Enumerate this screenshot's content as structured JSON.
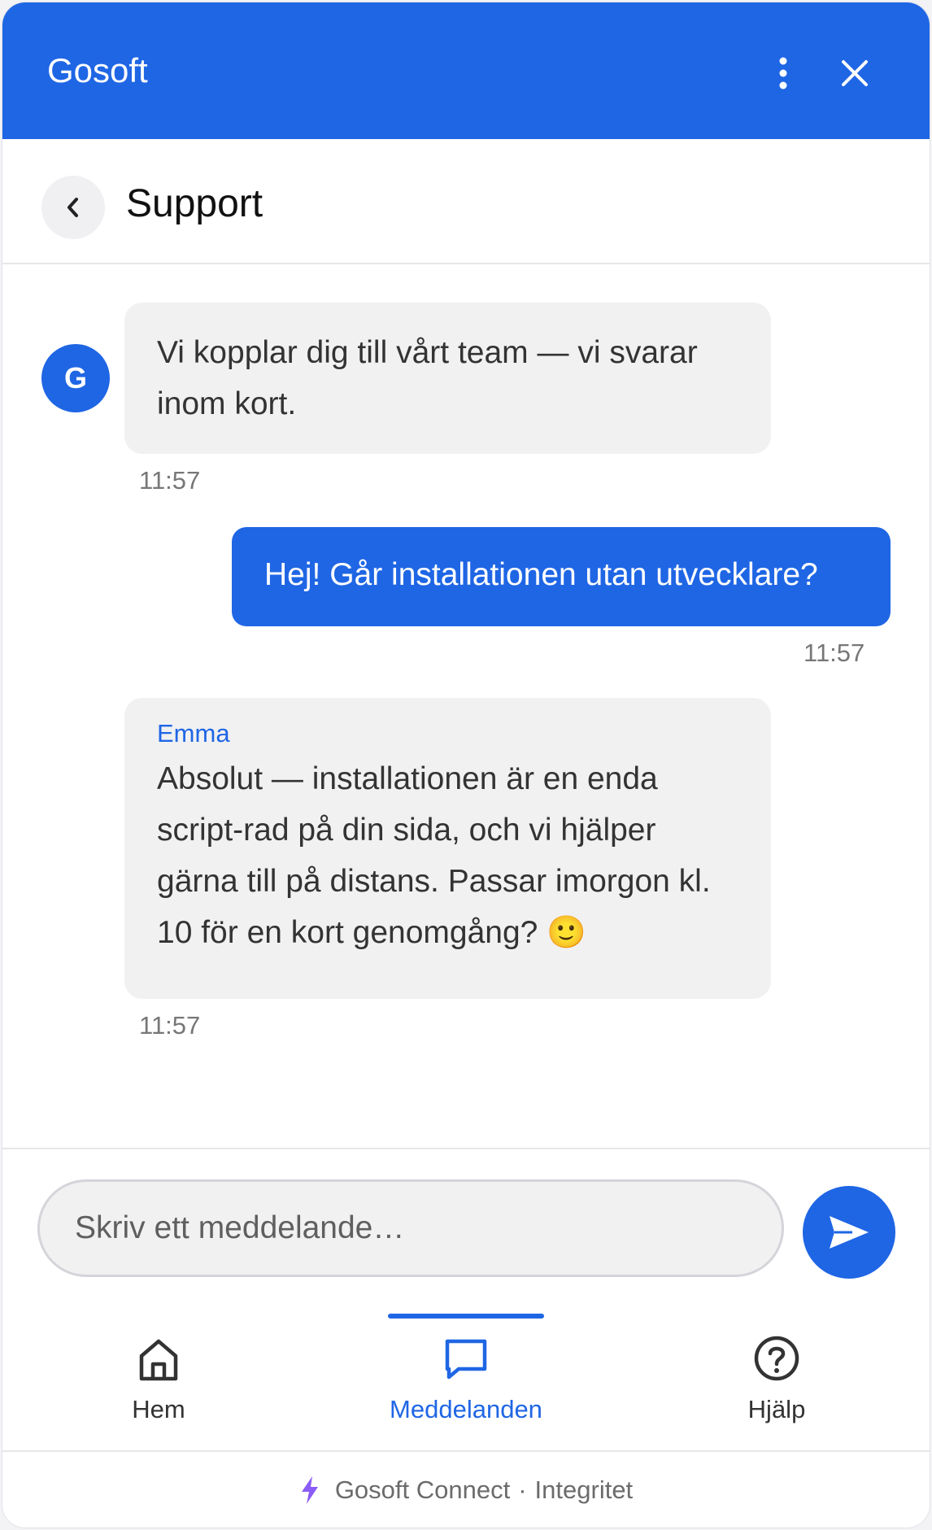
{
  "header": {
    "title": "Gosoft",
    "menu_icon": "more-vertical-icon",
    "close_icon": "close-icon",
    "color": "#1f66e5"
  },
  "subheader": {
    "back_icon": "chevron-left-icon",
    "title": "Support"
  },
  "messages": [
    {
      "direction": "incoming",
      "avatar_letter": "G",
      "text": "Vi kopplar dig till vårt team — vi svarar inom kort.",
      "time": "11:57"
    },
    {
      "direction": "outgoing",
      "text": "Hej! Går installationen utan utvecklare?",
      "time": "11:57"
    },
    {
      "direction": "incoming",
      "sender": "Emma",
      "text": "Absolut — installationen är en enda script-rad på din sida, och vi hjälper gärna till på distans. Passar imorgon kl. 10 för en kort genomgång? 🙂",
      "time": "11:57"
    }
  ],
  "composer": {
    "placeholder": "Skriv ett meddelande…",
    "value": "",
    "send_icon": "send-icon"
  },
  "nav": {
    "items": [
      {
        "label": "Hem",
        "icon": "home-icon",
        "active": false
      },
      {
        "label": "Meddelanden",
        "icon": "message-icon",
        "active": true
      },
      {
        "label": "Hjälp",
        "icon": "help-icon",
        "active": false
      }
    ]
  },
  "footer": {
    "icon": "bolt-icon",
    "brand": "Gosoft Connect",
    "separator": "·",
    "privacy": "Integritet"
  },
  "colors": {
    "accent": "#1f66e5",
    "bubble_in": "#f1f1f2"
  }
}
